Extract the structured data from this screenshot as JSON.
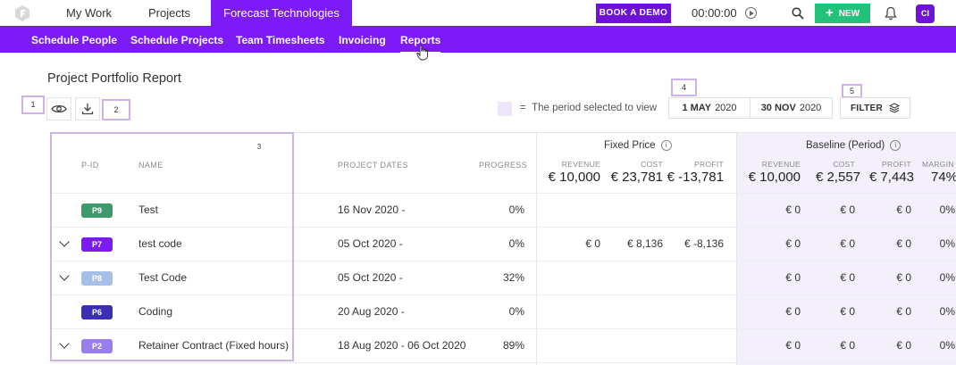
{
  "topnav": {
    "items": [
      "My Work",
      "Projects",
      "Forecast Technologies"
    ],
    "book_demo": "BOOK A DEMO",
    "timer": "00:00:00",
    "new_label": "NEW",
    "avatar": "CI"
  },
  "subnav": {
    "items": [
      "Schedule People",
      "Schedule Projects",
      "Team Timesheets",
      "Invoicing",
      "Reports"
    ],
    "active": "Reports"
  },
  "page": {
    "title": "Project Portfolio Report",
    "callouts": [
      "1",
      "2",
      "3",
      "4",
      "5"
    ],
    "legend_symbol": "=",
    "legend_text": "The period selected to view",
    "start_date_bold": "1 MAY",
    "start_date_year": "2020",
    "end_date_bold": "30 NOV",
    "end_date_year": "2020",
    "filter": "FILTER"
  },
  "table": {
    "headers": {
      "pid": "P-ID",
      "name": "NAME",
      "dates": "PROJECT DATES",
      "progress": "PROGRESS"
    },
    "fixed_price": {
      "title": "Fixed Price",
      "revenue_label": "REVENUE",
      "cost_label": "COST",
      "profit_label": "PROFIT",
      "revenue": "€ 10,000",
      "cost": "€ 23,781",
      "profit": "€ -13,781"
    },
    "baseline": {
      "title": "Baseline (Period)",
      "revenue_label": "REVENUE",
      "cost_label": "COST",
      "profit_label": "PROFIT",
      "margin_label": "MARGIN",
      "revenue": "€ 10,000",
      "cost": "€ 2,557",
      "profit": "€ 7,443",
      "margin": "74%"
    },
    "rows": [
      {
        "pid": "P9",
        "color": "#3d9a6a",
        "name": "Test",
        "dates": "16 Nov 2020 -",
        "progress": "0%",
        "fp_rev": "",
        "fp_cost": "",
        "fp_profit": "",
        "bl_rev": "€ 0",
        "bl_cost": "€ 0",
        "bl_profit": "€ 0",
        "bl_margin": "0%",
        "expand": false
      },
      {
        "pid": "P7",
        "color": "#7c1bf5",
        "name": "test code",
        "dates": "05 Oct 2020 -",
        "progress": "0%",
        "fp_rev": "€ 0",
        "fp_cost": "€ 8,136",
        "fp_profit": "€ -8,136",
        "bl_rev": "€ 0",
        "bl_cost": "€ 0",
        "bl_profit": "€ 0",
        "bl_margin": "0%",
        "expand": true
      },
      {
        "pid": "P8",
        "color": "#a6bfe8",
        "name": "Test Code",
        "dates": "05 Oct 2020 -",
        "progress": "32%",
        "fp_rev": "",
        "fp_cost": "",
        "fp_profit": "",
        "bl_rev": "€ 0",
        "bl_cost": "€ 0",
        "bl_profit": "€ 0",
        "bl_margin": "0%",
        "expand": true
      },
      {
        "pid": "P6",
        "color": "#3a2fb5",
        "name": "Coding",
        "dates": "20 Aug 2020 -",
        "progress": "0%",
        "fp_rev": "",
        "fp_cost": "",
        "fp_profit": "",
        "bl_rev": "€ 0",
        "bl_cost": "€ 0",
        "bl_profit": "€ 0",
        "bl_margin": "0%",
        "expand": false
      },
      {
        "pid": "P2",
        "color": "#9a7ef0",
        "name": "Retainer Contract (Fixed hours)",
        "dates": "18 Aug 2020 - 06 Oct 2020",
        "progress": "89%",
        "fp_rev": "",
        "fp_cost": "",
        "fp_profit": "",
        "bl_rev": "€ 0",
        "bl_cost": "€ 0",
        "bl_profit": "€ 0",
        "bl_margin": "0%",
        "expand": true
      }
    ]
  }
}
